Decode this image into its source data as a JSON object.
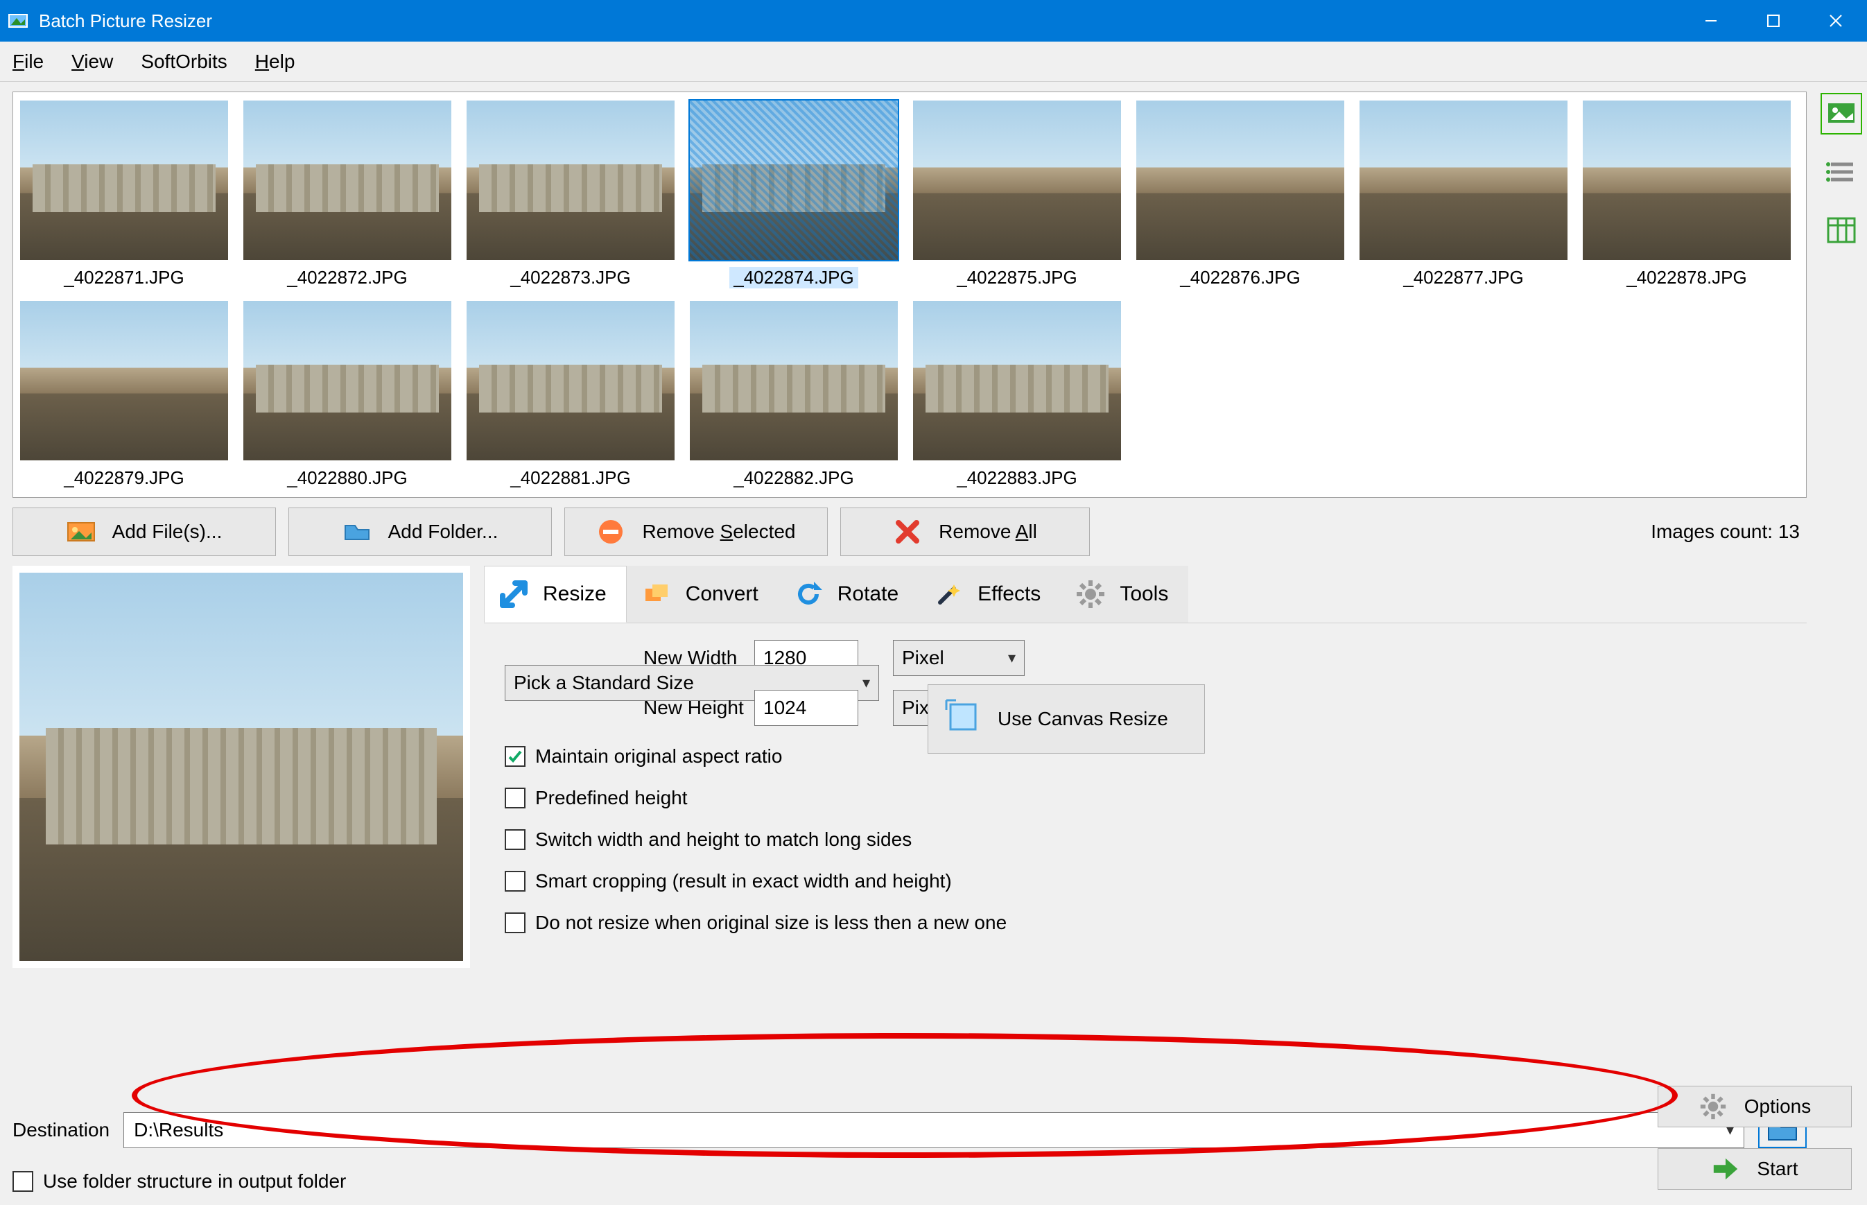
{
  "titlebar": {
    "title": "Batch Picture Resizer"
  },
  "menubar": {
    "file": "File",
    "view": "View",
    "softorbits": "SoftOrbits",
    "help": "Help"
  },
  "gallery": {
    "row1": [
      {
        "name": "_4022871.JPG",
        "selected": false,
        "flat": false
      },
      {
        "name": "_4022872.JPG",
        "selected": false,
        "flat": false
      },
      {
        "name": "_4022873.JPG",
        "selected": false,
        "flat": false
      },
      {
        "name": "_4022874.JPG",
        "selected": true,
        "flat": false
      },
      {
        "name": "_4022875.JPG",
        "selected": false,
        "flat": true
      },
      {
        "name": "_4022876.JPG",
        "selected": false,
        "flat": true
      },
      {
        "name": "_4022877.JPG",
        "selected": false,
        "flat": true
      },
      {
        "name": "_4022878.JPG",
        "selected": false,
        "flat": true
      }
    ],
    "row2": [
      {
        "name": "_4022879.JPG",
        "selected": false,
        "flat": true
      },
      {
        "name": "_4022880.JPG",
        "selected": false,
        "flat": false
      },
      {
        "name": "_4022881.JPG",
        "selected": false,
        "flat": false
      },
      {
        "name": "_4022882.JPG",
        "selected": false,
        "flat": false
      },
      {
        "name": "_4022883.JPG",
        "selected": false,
        "flat": false
      }
    ]
  },
  "actions": {
    "add_file": "Add File(s)...",
    "add_folder": "Add Folder...",
    "remove_sel": "Remove Selected",
    "remove_all": "Remove All",
    "images_count_label": "Images count: 13"
  },
  "tabs": {
    "resize": "Resize",
    "convert": "Convert",
    "rotate": "Rotate",
    "effects": "Effects",
    "tools": "Tools"
  },
  "resize_form": {
    "new_width_label": "New Width",
    "new_width_value": "1280",
    "width_unit": "Pixel",
    "new_height_label": "New Height",
    "new_height_value": "1024",
    "height_unit": "Pixel",
    "std_size": "Pick a Standard Size",
    "chk_aspect": "Maintain original aspect ratio",
    "chk_predef": "Predefined height",
    "chk_switch": "Switch width and height to match long sides",
    "chk_smart": "Smart cropping (result in exact width and height)",
    "chk_noresize": "Do not resize when original size is less then a new one",
    "use_canvas": "Use Canvas Resize"
  },
  "destination": {
    "label": "Destination",
    "value": "D:\\Results",
    "use_folder_structure": "Use folder structure in output folder"
  },
  "buttons": {
    "options": "Options",
    "start": "Start"
  }
}
